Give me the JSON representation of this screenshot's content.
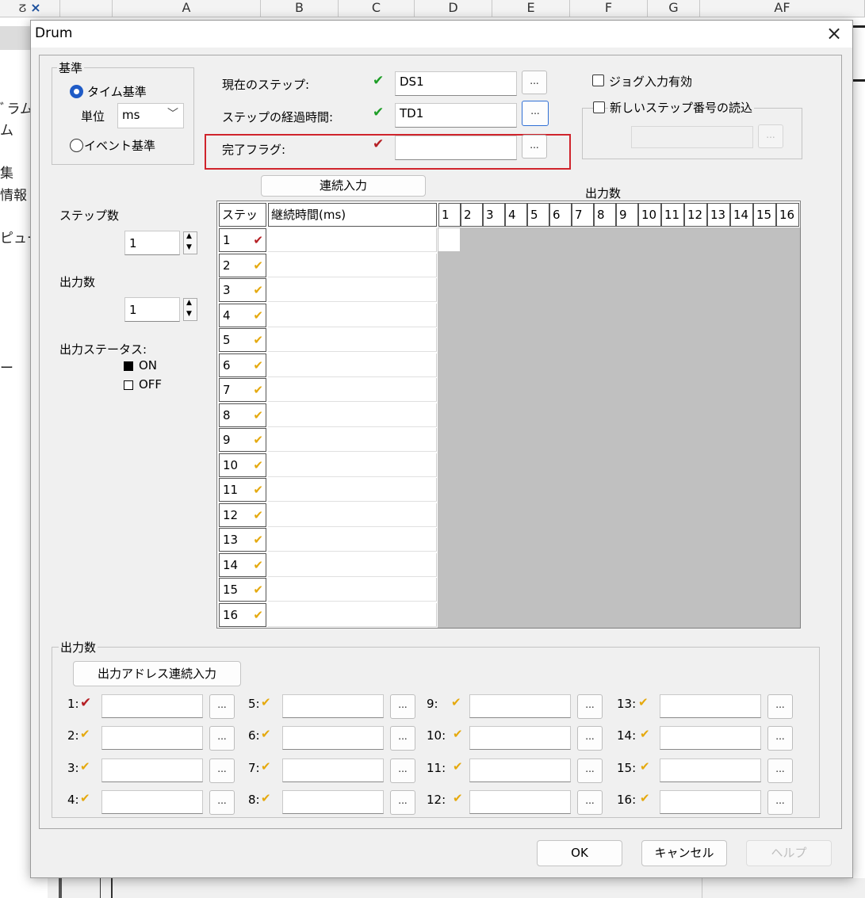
{
  "background": {
    "columns": [
      "A",
      "B",
      "C",
      "D",
      "E",
      "F",
      "G",
      "AF"
    ],
    "side_texts": [
      "ﾞラム",
      "ム",
      "集",
      "情報",
      "ピュー",
      "ー"
    ]
  },
  "dialog": {
    "title": "Drum",
    "close_icon": "×",
    "basis": {
      "legend": "基準",
      "time_basis": "タイム基準",
      "unit_label": "単位",
      "unit_value": "ms",
      "event_basis": "イベント基準"
    },
    "current_step": {
      "label": "現在のステップ:",
      "value": "DS1",
      "browse": "..."
    },
    "step_elapsed": {
      "label": "ステップの経過時間:",
      "value": "TD1",
      "browse": "..."
    },
    "complete_flag": {
      "label": "完了フラグ:",
      "value": "",
      "browse": "..."
    },
    "jog_enable": "ジョグ入力有効",
    "read_new_step": {
      "label": "新しいステップ番号の読込",
      "value": "",
      "browse": "..."
    },
    "continuous_input_button": "連続入力",
    "outputs_header": "出力数",
    "step_count": {
      "label": "ステップ数",
      "value": "1"
    },
    "output_count": {
      "label": "出力数",
      "value": "1"
    },
    "output_status": {
      "label": "出力ステータス:",
      "on": "ON",
      "off": "OFF"
    },
    "table": {
      "step_header": "ステップ",
      "duration_header": "継続時間(ms)",
      "output_columns": [
        "1",
        "2",
        "3",
        "4",
        "5",
        "6",
        "7",
        "8",
        "9",
        "10",
        "11",
        "12",
        "13",
        "14",
        "15",
        "16"
      ],
      "rows": [
        "1",
        "2",
        "3",
        "4",
        "5",
        "6",
        "7",
        "8",
        "9",
        "10",
        "11",
        "12",
        "13",
        "14",
        "15",
        "16"
      ]
    },
    "outputs_group": {
      "legend": "出力数",
      "address_button": "出力アドレス連続入力",
      "items": [
        {
          "label": "1:",
          "value": ""
        },
        {
          "label": "2:",
          "value": ""
        },
        {
          "label": "3:",
          "value": ""
        },
        {
          "label": "4:",
          "value": ""
        },
        {
          "label": "5:",
          "value": ""
        },
        {
          "label": "6:",
          "value": ""
        },
        {
          "label": "7:",
          "value": ""
        },
        {
          "label": "8:",
          "value": ""
        },
        {
          "label": "9:",
          "value": ""
        },
        {
          "label": "10:",
          "value": ""
        },
        {
          "label": "11:",
          "value": ""
        },
        {
          "label": "12:",
          "value": ""
        },
        {
          "label": "13:",
          "value": ""
        },
        {
          "label": "14:",
          "value": ""
        },
        {
          "label": "15:",
          "value": ""
        },
        {
          "label": "16:",
          "value": ""
        }
      ],
      "browse": "..."
    },
    "ok_button": "OK",
    "cancel_button": "キャンセル",
    "help_button": "ヘルプ"
  },
  "colors": {
    "valid_check": "#1e9e27",
    "invalid_check": "#b51f24",
    "pending_check": "#e5a90e",
    "highlight_box": "#d0242c",
    "grid_fill": "#c0c0c0",
    "radio_selected": "#1f5bc6"
  }
}
